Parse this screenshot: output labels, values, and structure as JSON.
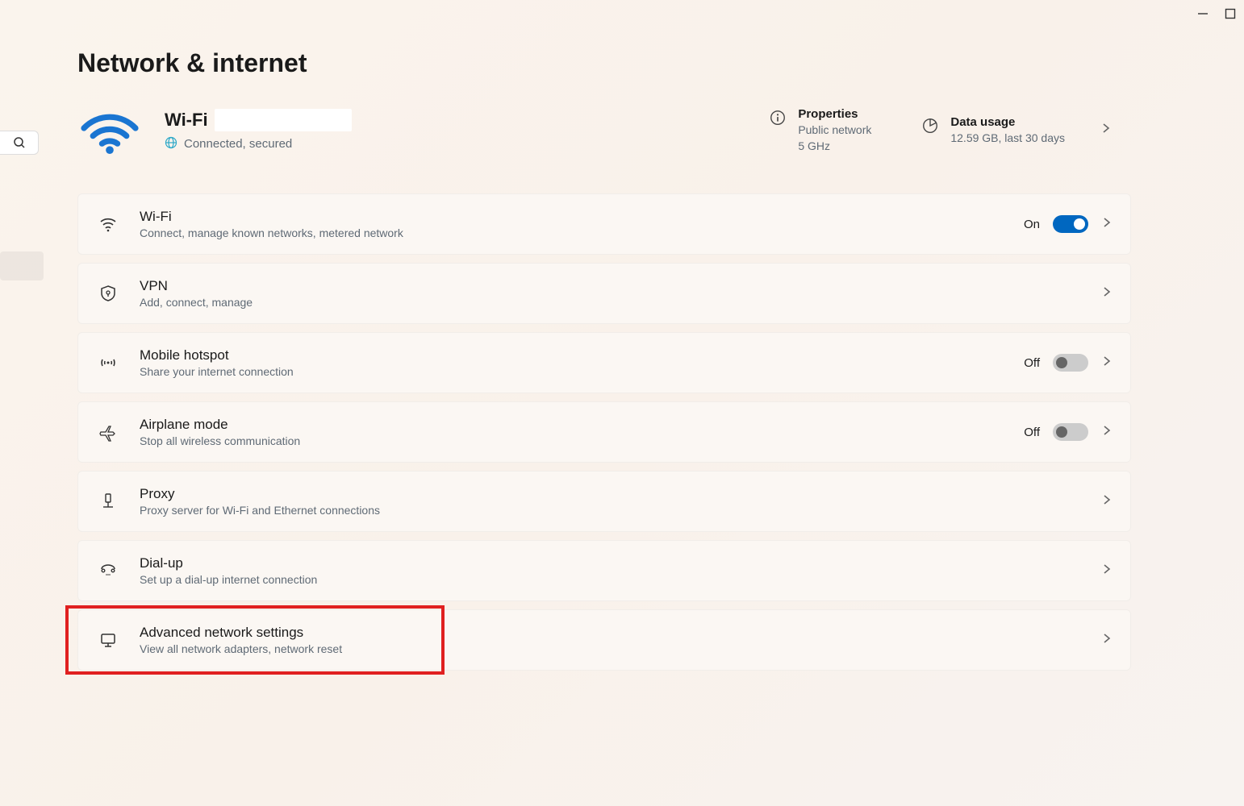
{
  "page": {
    "title": "Network & internet"
  },
  "status": {
    "name": "Wi-Fi",
    "connected_text": "Connected, secured"
  },
  "properties": {
    "title": "Properties",
    "line1": "Public network",
    "line2": "5 GHz"
  },
  "data_usage": {
    "title": "Data usage",
    "line1": "12.59 GB, last 30 days"
  },
  "items": {
    "wifi": {
      "title": "Wi-Fi",
      "sub": "Connect, manage known networks, metered network",
      "toggle_label": "On",
      "toggle_on": true
    },
    "vpn": {
      "title": "VPN",
      "sub": "Add, connect, manage"
    },
    "hotspot": {
      "title": "Mobile hotspot",
      "sub": "Share your internet connection",
      "toggle_label": "Off",
      "toggle_on": false
    },
    "airplane": {
      "title": "Airplane mode",
      "sub": "Stop all wireless communication",
      "toggle_label": "Off",
      "toggle_on": false
    },
    "proxy": {
      "title": "Proxy",
      "sub": "Proxy server for Wi-Fi and Ethernet connections"
    },
    "dialup": {
      "title": "Dial-up",
      "sub": "Set up a dial-up internet connection"
    },
    "advanced": {
      "title": "Advanced network settings",
      "sub": "View all network adapters, network reset"
    }
  }
}
